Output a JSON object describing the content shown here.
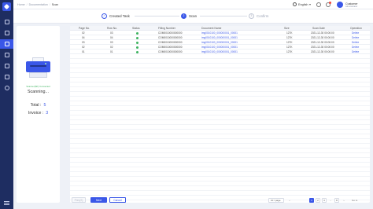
{
  "breadcrumb": [
    "Home",
    "Documentation",
    "Scan"
  ],
  "header": {
    "language": "English",
    "user_name": "Customer",
    "user_role": "Administrator"
  },
  "steps": [
    {
      "label": "Created Task",
      "number": "✓",
      "state": "done"
    },
    {
      "label": "Scan",
      "number": "2",
      "state": "active"
    },
    {
      "label": "Confirm",
      "number": "3",
      "state": "wait"
    }
  ],
  "scanner": {
    "connection": "Scanner(SP) Connected",
    "status": "Scanning...",
    "total_label": "Total",
    "total_value": "5",
    "invoice_label": "Invoice",
    "invoice_value": "3"
  },
  "table": {
    "columns": [
      "Page No.",
      "Row No.",
      "Status",
      "Filling Number",
      "Document Name",
      "Size",
      "Scan Date",
      "Operation"
    ],
    "rows": [
      {
        "page": "02",
        "row": "03",
        "status": "success",
        "filing": "COM0010000000000",
        "doc": "img0010100_000000001_00001",
        "size": "127K",
        "date": "2021-12-30 00:00:00",
        "op": "Delete"
      },
      {
        "page": "04",
        "row": "04",
        "status": "success",
        "filing": "COM0010000000000",
        "doc": "img0010100_000000001_00001",
        "size": "127K",
        "date": "2021-12-30 00:00:00",
        "op": "Delete"
      },
      {
        "page": "03",
        "row": "03",
        "status": "success",
        "filing": "COM0010000000000",
        "doc": "img0010100_000000001_00001",
        "size": "127K",
        "date": "2021-12-30 00:00:00",
        "op": "Delete"
      },
      {
        "page": "02",
        "row": "02",
        "status": "success",
        "filing": "COM0010000000000",
        "doc": "img0010100_000000001_00001",
        "size": "127K",
        "date": "2021-12-30 00:00:00",
        "op": "Delete"
      },
      {
        "page": "01",
        "row": "01",
        "status": "success",
        "filing": "COM0010000000000",
        "doc": "img0010100_000000001_00001",
        "size": "127K",
        "date": "2021-12-30 00:00:00",
        "op": "Delete"
      }
    ]
  },
  "footer": {
    "prev_label": "Prev(S)",
    "next_label": "Next",
    "cancel_label": "Cancel"
  },
  "pagination": {
    "page_size": "10 / page",
    "prev": "‹",
    "pages": [
      "1",
      "2",
      "3",
      "...",
      "8"
    ],
    "current": "1",
    "next": "›",
    "goto": "Go to"
  },
  "colors": {
    "sidebar": "#1e2d61",
    "accent": "#3a57e8",
    "success": "#3db35f",
    "background": "#eef1f7"
  },
  "icons": {
    "sidebar": [
      "home-icon",
      "document-icon",
      "scan-icon",
      "folder-icon",
      "report-icon",
      "archive-icon",
      "settings-icon"
    ]
  }
}
